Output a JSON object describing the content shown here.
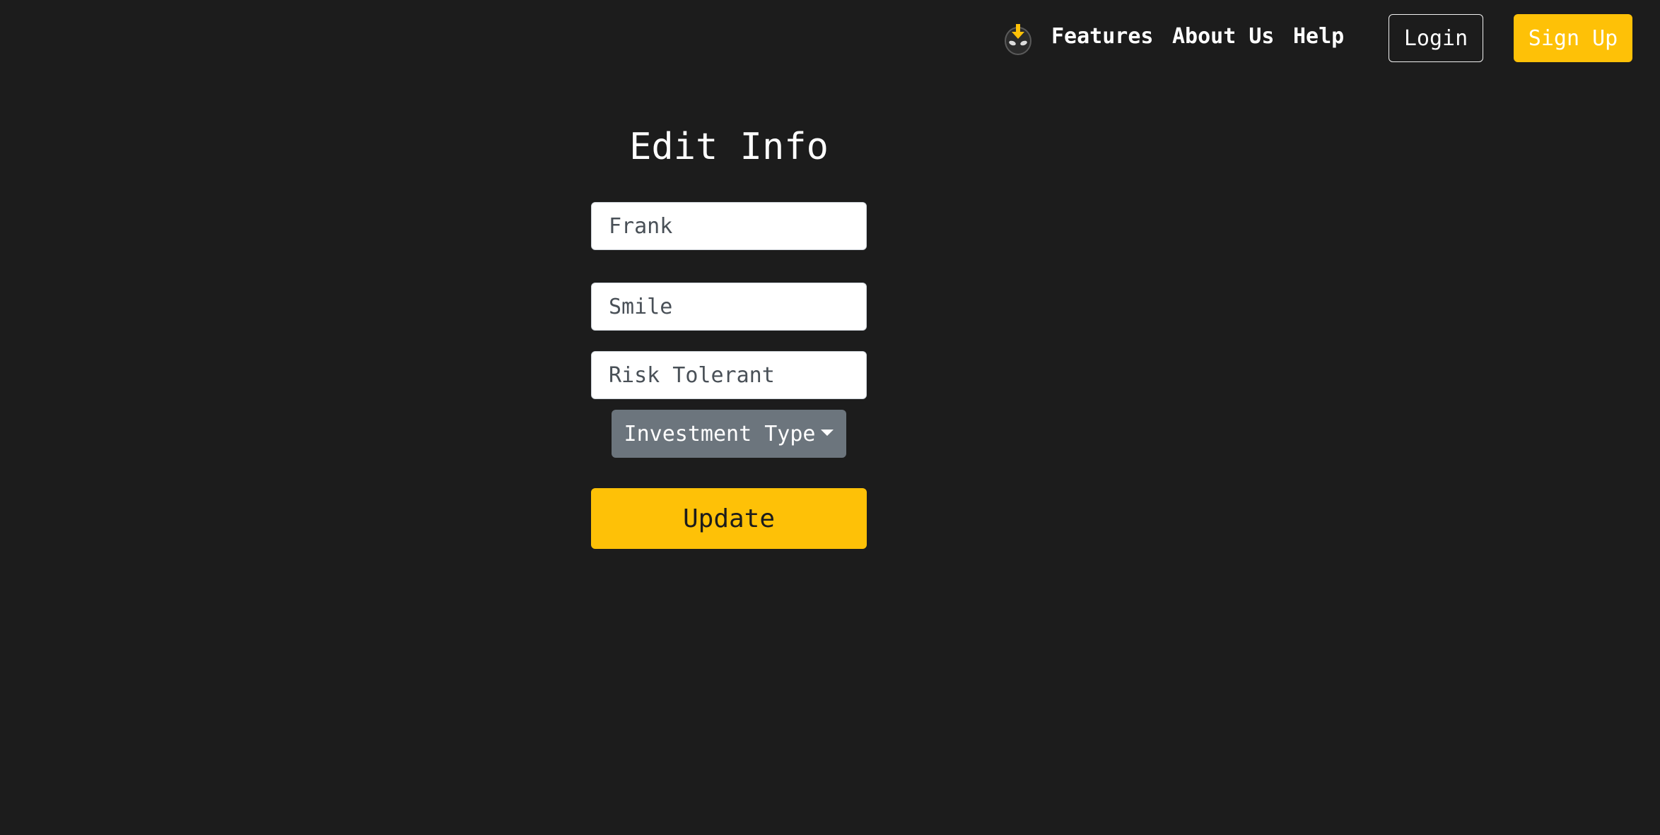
{
  "nav": {
    "logo_icon": "alien-download-icon",
    "features_label": "Features",
    "about_label": "About Us",
    "help_label": "Help",
    "login_label": "Login",
    "signup_label": "Sign Up"
  },
  "form": {
    "title": "Edit Info",
    "first_name_value": "Frank",
    "last_name_value": "Smile",
    "risk_value": "Risk Tolerant",
    "investment_type_label": "Investment Type",
    "update_label": "Update"
  },
  "colors": {
    "background": "#1c1c1c",
    "accent": "#fec107",
    "secondary": "#6c757d"
  }
}
